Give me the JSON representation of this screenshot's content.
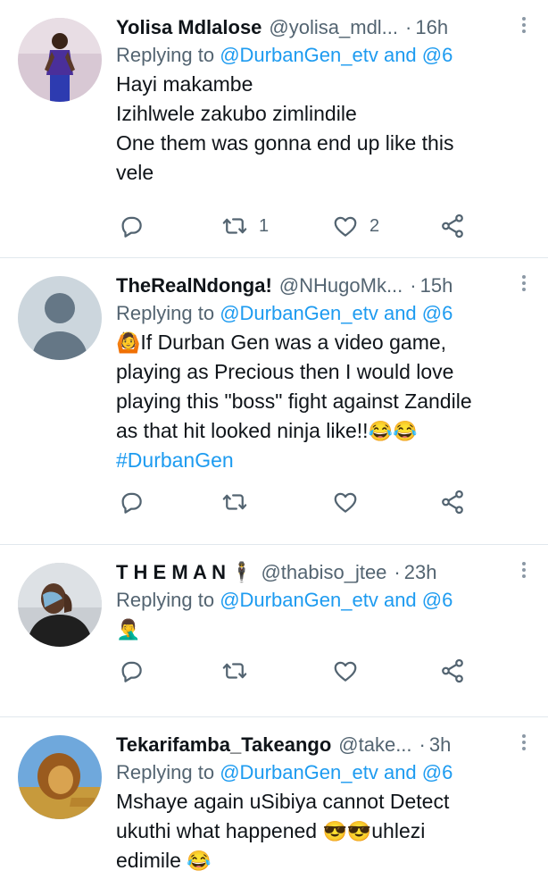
{
  "tweets": [
    {
      "name": "Yolisa Mdlalose",
      "handle": "@yolisa_mdl...",
      "time": "16h",
      "reply_prefix": "Replying to ",
      "reply_mentions": "@DurbanGen_etv and @6",
      "lines": [
        "Hayi makambe",
        "Izihlwele zakubo zimlindile",
        "One them was gonna end up like this",
        "vele"
      ],
      "retweets": "1",
      "likes": "2"
    },
    {
      "name": "TheRealNdonga!",
      "handle": "@NHugoMk...",
      "time": "15h",
      "reply_prefix": "Replying to ",
      "reply_mentions": "@DurbanGen_etv and @6",
      "lines": [
        "If Durban Gen was a video game,",
        "playing as Precious then I would love",
        "playing this \"boss\" fight against Zandile",
        "as that hit looked ninja like!!"
      ],
      "hashtag": "#DurbanGen",
      "emoji_lead": "🙆",
      "emoji_tail": "😂😂",
      "retweets": "",
      "likes": ""
    },
    {
      "name": "T H E M A N",
      "name_emoji": "🕴",
      "handle": "@thabiso_jtee",
      "time": "23h",
      "reply_prefix": "Replying to ",
      "reply_mentions": "@DurbanGen_etv and @6",
      "emoji_body": "🤦‍♂️",
      "retweets": "",
      "likes": ""
    },
    {
      "name": "Tekarifamba_Takeango",
      "handle": "@take...",
      "time": "3h",
      "reply_prefix": "Replying to ",
      "reply_mentions": "@DurbanGen_etv and @6",
      "lines": [
        "Mshaye again uSibiya cannot Detect",
        "ukuthi what happened",
        "edimile"
      ],
      "emoji_mid": "😎😎",
      "line2_tail": "uhlezi",
      "emoji_end": "😂"
    }
  ],
  "icons": {
    "reply": "reply-icon",
    "retweet": "retweet-icon",
    "like": "heart-icon",
    "share": "share-icon",
    "more": "more-vertical-icon"
  },
  "colors": {
    "text": "#0f1419",
    "secondary": "#536471",
    "link": "#1d9bf0",
    "divider": "#e1e8ed"
  }
}
